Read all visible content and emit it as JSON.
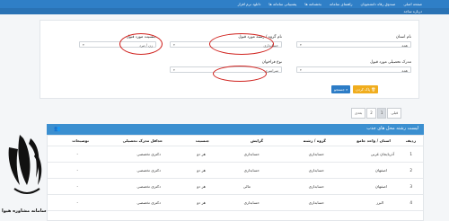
{
  "nav": {
    "items": [
      "صفحه اصلی",
      "صندوق رفاه دانشجویان",
      "راهنمای سامانه",
      "بخشنامه ها",
      "پشتیبانی سامانه ها",
      "دانلود نرم افزار"
    ],
    "sub_item": "درباره ساجد"
  },
  "filters": {
    "province": {
      "label": "نام استان",
      "value": "همه"
    },
    "group": {
      "label": "نام گروه / رشته مورد قبول",
      "value": "حسابداری"
    },
    "gender": {
      "label": "جنسیت مورد قبول",
      "value": "زن / مرد"
    },
    "education": {
      "label": "مدرک تحصیلی مورد قبول",
      "value": "همه"
    },
    "call_type": {
      "label": "نوع فراخوان",
      "value": "سراسری"
    }
  },
  "buttons": {
    "search": "جستجو",
    "reset": "پاک کردن"
  },
  "pager": {
    "prev": "قبلی",
    "pages": [
      "1",
      "2"
    ],
    "next": "بعدی"
  },
  "table": {
    "title": "لیست رشته محل های جذب",
    "headers": [
      "ردیف",
      "استان / واحد جامع",
      "گروه / رشته",
      "گرایش",
      "جنسیت",
      "حداقل مدرک تحصیلی",
      "توضیحات"
    ],
    "rows": [
      [
        "1",
        "آذربایجان غربی",
        "حسابداری",
        "حسابداری",
        "هر دو",
        "دکتری تخصصی",
        "-"
      ],
      [
        "2",
        "اصفهان",
        "حسابداری",
        "حسابداری",
        "هر دو",
        "دکتری تخصصی",
        "-"
      ],
      [
        "3",
        "اصفهان",
        "حسابداری",
        "مالی",
        "هر دو",
        "دکتری تخصصی",
        "-"
      ],
      [
        "4",
        "البرز",
        "حسابداری",
        "حسابداری",
        "هر دو",
        "دکتری تخصصی",
        "-"
      ]
    ]
  },
  "watermark": {
    "text": "سامانه مشاوره هیوا"
  },
  "colors": {
    "nav": "#2f7fc7",
    "highlight": "#d0231f",
    "search_button": "#2c7cc6",
    "reset_button": "#f0ad1e"
  }
}
